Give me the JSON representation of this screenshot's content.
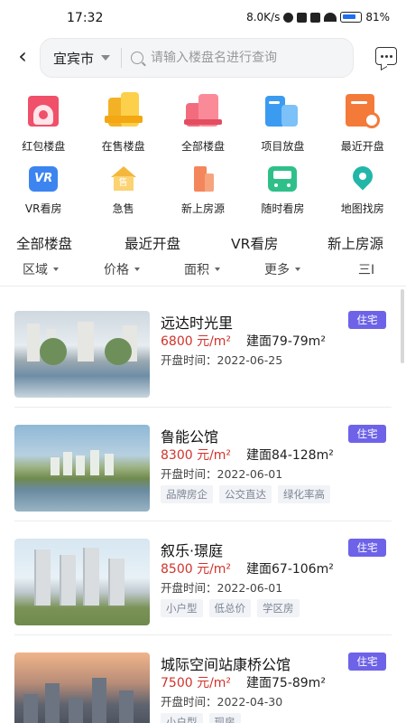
{
  "status_bar": {
    "time": "17:32",
    "network_speed": "8.0K/s",
    "battery": "81%"
  },
  "header": {
    "city": "宜宾市",
    "search_placeholder": "请输入楼盘名进行查询"
  },
  "categories_row1": [
    {
      "label": "红包楼盘",
      "icon": "red-envelope-building-icon"
    },
    {
      "label": "在售楼盘",
      "icon": "on-sale-building-icon"
    },
    {
      "label": "全部楼盘",
      "icon": "all-buildings-icon"
    },
    {
      "label": "项目放盘",
      "icon": "project-listing-icon"
    },
    {
      "label": "最近开盘",
      "icon": "recent-opening-icon"
    }
  ],
  "categories_row2": [
    {
      "label": "VR看房",
      "icon": "vr-icon",
      "icon_text": "VR"
    },
    {
      "label": "急售",
      "icon": "urgent-sale-icon",
      "icon_text": "售"
    },
    {
      "label": "新上房源",
      "icon": "new-listing-icon"
    },
    {
      "label": "随时看房",
      "icon": "bus-icon"
    },
    {
      "label": "地图找房",
      "icon": "map-pin-icon"
    }
  ],
  "tabs": [
    "全部楼盘",
    "最近开盘",
    "VR看房",
    "新上房源"
  ],
  "filters": [
    "区域",
    "价格",
    "面积",
    "更多",
    "三Ⅰ"
  ],
  "listings": [
    {
      "name": "远达时光里",
      "price": "6800 元/m²",
      "area": "建面79-79m²",
      "open_date": "开盘时间：2022-06-25",
      "type": "住宅",
      "tags": []
    },
    {
      "name": "鲁能公馆",
      "price": "8300 元/m²",
      "area": "建面84-128m²",
      "open_date": "开盘时间：2022-06-01",
      "type": "住宅",
      "tags": [
        "品牌房企",
        "公交直达",
        "绿化率高"
      ]
    },
    {
      "name": "叙乐·璟庭",
      "price": "8500 元/m²",
      "area": "建面67-106m²",
      "open_date": "开盘时间：2022-06-01",
      "type": "住宅",
      "tags": [
        "小户型",
        "低总价",
        "学区房"
      ]
    },
    {
      "name": "城际空间站康桥公馆",
      "price": "7500 元/m²",
      "area": "建面75-89m²",
      "open_date": "开盘时间：2022-04-30",
      "type": "住宅",
      "tags": [
        "小户型",
        "现房"
      ]
    }
  ],
  "colors": {
    "price": "#d0342c",
    "type_badge": "#6e63e8",
    "tag_bg": "#f1f3f7"
  }
}
